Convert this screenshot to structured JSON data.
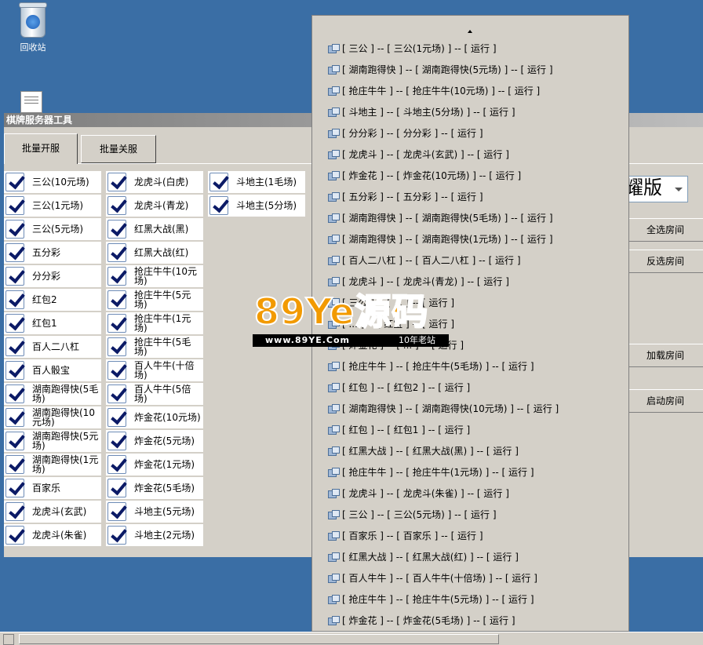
{
  "desktop": {
    "recycle_label": "回收站"
  },
  "window": {
    "title": "棋牌服务器工具",
    "tabs": [
      "批量开服",
      "批量关服"
    ],
    "combo_value": "耀版",
    "buttons": {
      "select_all": "全选房间",
      "invert": "反选房间",
      "load": "加载房间",
      "start": "启动房间"
    }
  },
  "checklist": {
    "col1": [
      "三公(10元场)",
      "三公(1元场)",
      "三公(5元场)",
      "五分彩",
      "分分彩",
      "红包2",
      "红包1",
      "百人二八杠",
      "百人骰宝",
      "湖南跑得快(5毛场)",
      "湖南跑得快(10元场)",
      "湖南跑得快(5元场)",
      "湖南跑得快(1元场)",
      "百家乐",
      "龙虎斗(玄武)",
      "龙虎斗(朱雀)"
    ],
    "col2": [
      "龙虎斗(白虎)",
      "龙虎斗(青龙)",
      "红黑大战(黑)",
      "红黑大战(红)",
      "抢庄牛牛(10元场)",
      "抢庄牛牛(5元场)",
      "抢庄牛牛(1元场)",
      "抢庄牛牛(5毛场)",
      "百人牛牛(十倍场)",
      "百人牛牛(5倍场)",
      "炸金花(10元场)",
      "炸金花(5元场)",
      "炸金花(1元场)",
      "炸金花(5毛场)",
      "斗地主(5元场)",
      "斗地主(2元场)"
    ],
    "col3": [
      "斗地主(1毛场)",
      "斗地主(5分场)"
    ]
  },
  "popup_rows": [
    "[ 三公 ] -- [ 三公(1元场) ] -- [ 运行 ]",
    "[ 湖南跑得快 ] -- [ 湖南跑得快(5元场) ] -- [ 运行 ]",
    "[ 抢庄牛牛 ] -- [ 抢庄牛牛(10元场) ] -- [ 运行 ]",
    "[ 斗地主 ] -- [ 斗地主(5分场) ] -- [ 运行 ]",
    "[ 分分彩 ] -- [ 分分彩 ] -- [ 运行 ]",
    "[ 龙虎斗 ] -- [ 龙虎斗(玄武) ] -- [ 运行 ]",
    "[ 炸金花 ] -- [ 炸金花(10元场) ] -- [ 运行 ]",
    "[ 五分彩 ] -- [ 五分彩 ] -- [ 运行 ]",
    "[ 湖南跑得快 ] -- [ 湖南跑得快(5毛场) ] -- [ 运行 ]",
    "[ 湖南跑得快 ] -- [ 湖南跑得快(1元场) ] -- [ 运行 ]",
    "[ 百人二八杠 ] -- [ 百人二八杠 ] -- [ 运行 ]",
    "[ 龙虎斗 ] -- [ 龙虎斗(青龙) ] -- [ 运行 ]",
    "[ 三公 ] -- [ ... ] -- [ 运行 ]",
    "[ ... ] -- [ 红宝 ] -- [ 运行 ]",
    "[ 炸金花 ] -- [ ... ] -- [ 运行 ]",
    "[ 抢庄牛牛 ] -- [ 抢庄牛牛(5毛场) ] -- [ 运行 ]",
    "[ 红包 ] -- [ 红包2 ] -- [ 运行 ]",
    "[ 湖南跑得快 ] -- [ 湖南跑得快(10元场) ] -- [ 运行 ]",
    "[ 红包 ] -- [ 红包1 ] -- [ 运行 ]",
    "[ 红黑大战 ] -- [ 红黑大战(黑) ] -- [ 运行 ]",
    "[ 抢庄牛牛 ] -- [ 抢庄牛牛(1元场) ] -- [ 运行 ]",
    "[ 龙虎斗 ] -- [ 龙虎斗(朱雀) ] -- [ 运行 ]",
    "[ 三公 ] -- [ 三公(5元场) ] -- [ 运行 ]",
    "[ 百家乐 ] -- [ 百家乐 ] -- [ 运行 ]",
    "[ 红黑大战 ] -- [ 红黑大战(红) ] -- [ 运行 ]",
    "[ 百人牛牛 ] -- [ 百人牛牛(十倍场) ] -- [ 运行 ]",
    "[ 抢庄牛牛 ] -- [ 抢庄牛牛(5元场) ] -- [ 运行 ]",
    "[ 炸金花 ] -- [ 炸金花(5毛场) ] -- [ 运行 ]"
  ],
  "watermark": {
    "brand": "89Ye源码",
    "url": "www.89YE.Com",
    "tag": "10年老站"
  }
}
